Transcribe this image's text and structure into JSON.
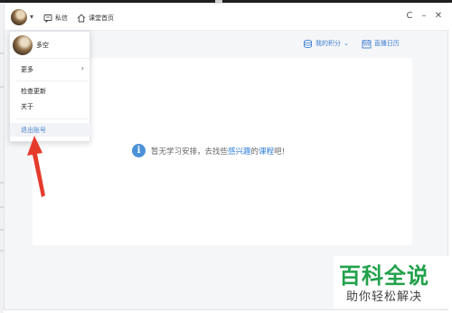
{
  "titlebar": {
    "messages_label": "私信",
    "home_label": "课堂首页"
  },
  "subbar": {
    "points_label": "我的积分",
    "calendar_label": "直播日历"
  },
  "menu": {
    "username": "多空",
    "more_label": "更多",
    "check_update_label": "检查更新",
    "about_label": "关于",
    "logout_label": "退出账号"
  },
  "main": {
    "empty_prefix": "暂无学习安排，去找些",
    "empty_link_1": "感兴趣",
    "empty_middle": "的",
    "empty_link_2": "课程",
    "empty_suffix": "吧!"
  },
  "watermark": {
    "title": "百科全说",
    "subtitle": "助你轻松解决"
  },
  "colors": {
    "accent": "#2f7fd8",
    "arrow": "#e53b2c",
    "watermark_green": "#22a14b"
  }
}
